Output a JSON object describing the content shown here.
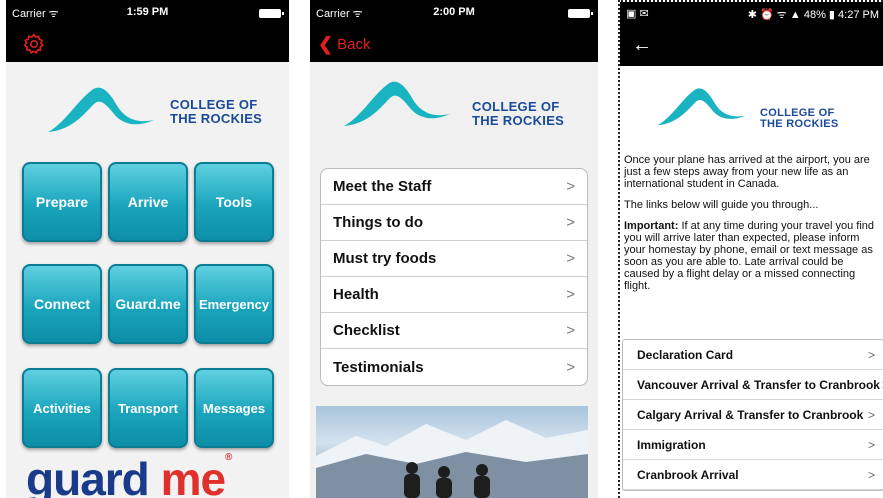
{
  "screen1": {
    "status": {
      "carrier": "Carrier ᯤ",
      "time": "1:59 PM"
    },
    "logo": {
      "line1": "COLLEGE OF",
      "line2": "THE ROCKIES"
    },
    "tiles": [
      "Prepare",
      "Arrive",
      "Tools",
      "Connect",
      "Guard.me",
      "Emergency",
      "Activities",
      "Transport",
      "Messages"
    ],
    "brand": {
      "part1": "guard",
      "part2": "me",
      "mark": "®"
    }
  },
  "screen2": {
    "status": {
      "carrier": "Carrier ᯤ",
      "time": "2:00 PM"
    },
    "back_label": "Back",
    "logo": {
      "line1": "COLLEGE OF",
      "line2": "THE ROCKIES"
    },
    "menu": [
      "Meet the Staff",
      "Things to do",
      "Must try foods",
      "Health",
      "Checklist",
      "Testimonials"
    ]
  },
  "screen3": {
    "status": {
      "left": "▣ ✉",
      "right": "✱ ⏰ ᯤ ▲ 48% ▮ 4:27 PM"
    },
    "logo": {
      "line1": "COLLEGE OF",
      "line2": "THE ROCKIES"
    },
    "intro": "Once your plane has arrived at the airport, you are just a few steps away from your new life as an international student in Canada.",
    "guide": "The links below will guide you through...",
    "important_label": "Important:",
    "important_text": " If at any time during your travel you find you will arrive later than expected, please inform your homestay by phone, email or text message as soon as you are able to. Late arrival could be caused by a flight delay or a missed connecting flight.",
    "menu": [
      "Declaration Card",
      "Vancouver Arrival & Transfer to Cranbrook",
      "Calgary Arrival & Transfer to Cranbrook",
      "Immigration",
      "Cranbrook Arrival"
    ]
  },
  "colors": {
    "accent_red": "#e02020",
    "tile_teal": "#1aa5bd",
    "logo_teal": "#19b3c2",
    "logo_text": "#1a4a9a"
  },
  "icons": [
    "gear-icon",
    "chevron-left-icon",
    "chevron-right-icon",
    "arrow-left-icon",
    "wifi-icon",
    "battery-icon"
  ]
}
